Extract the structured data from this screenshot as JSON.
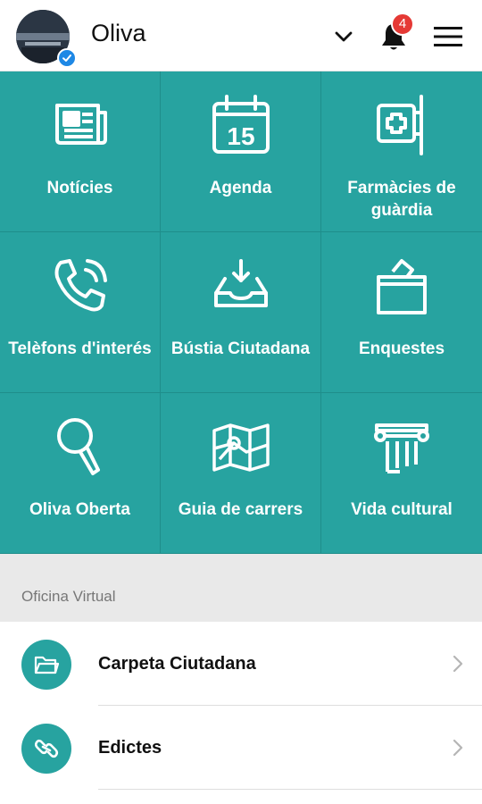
{
  "header": {
    "user_name": "Oliva",
    "notification_count": "4"
  },
  "tiles": [
    {
      "label": "Notícies",
      "icon": "newspaper-icon"
    },
    {
      "label": "Agenda",
      "icon": "calendar-icon",
      "icon_text": "15"
    },
    {
      "label": "Farmàcies de guàrdia",
      "icon": "pharmacy-sign-icon"
    },
    {
      "label": "Telèfons d'interés",
      "icon": "phone-icon"
    },
    {
      "label": "Bústia Ciutadana",
      "icon": "inbox-icon"
    },
    {
      "label": "Enquestes",
      "icon": "ballot-box-icon"
    },
    {
      "label": "Oliva Oberta",
      "icon": "magnifier-icon"
    },
    {
      "label": "Guia de carrers",
      "icon": "map-icon"
    },
    {
      "label": "Vida cultural",
      "icon": "column-icon"
    }
  ],
  "section": {
    "title": "Oficina Virtual"
  },
  "list": [
    {
      "label": "Carpeta Ciutadana",
      "icon": "folder-icon"
    },
    {
      "label": "Edictes",
      "icon": "link-icon"
    }
  ],
  "colors": {
    "teal": "#27a3a0",
    "badge": "#e53935",
    "verified": "#1e88e5"
  }
}
